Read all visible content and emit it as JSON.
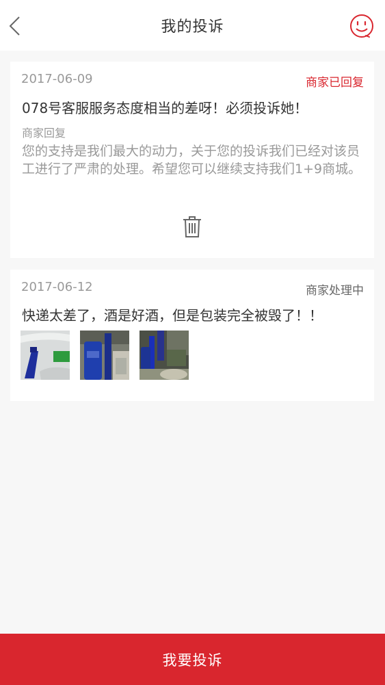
{
  "header": {
    "title": "我的投诉",
    "back_icon": "chevron-left-icon",
    "right_icon": "smile-face-icon",
    "accent_color": "#d9262e"
  },
  "complaints": [
    {
      "date": "2017-06-09",
      "status": "商家已回复",
      "status_color": "#d9262e",
      "text": "078号客服服务态度相当的差呀！必须投诉她！",
      "reply_label": "商家回复",
      "reply_text": "您的支持是我们最大的动力，关于您的投诉我们已经对该员工进行了严肃的处理。希望您可以继续支持我们1+9商城。",
      "action_icon": "trash-icon"
    },
    {
      "date": "2017-06-12",
      "status": "商家处理中",
      "status_color": "#666666",
      "text": "快递太差了，酒是好酒，但是包装完全被毁了！！",
      "photos": [
        "photo-bottle-1",
        "photo-bottle-2",
        "photo-bottle-3"
      ]
    }
  ],
  "footer": {
    "button_label": "我要投诉"
  }
}
